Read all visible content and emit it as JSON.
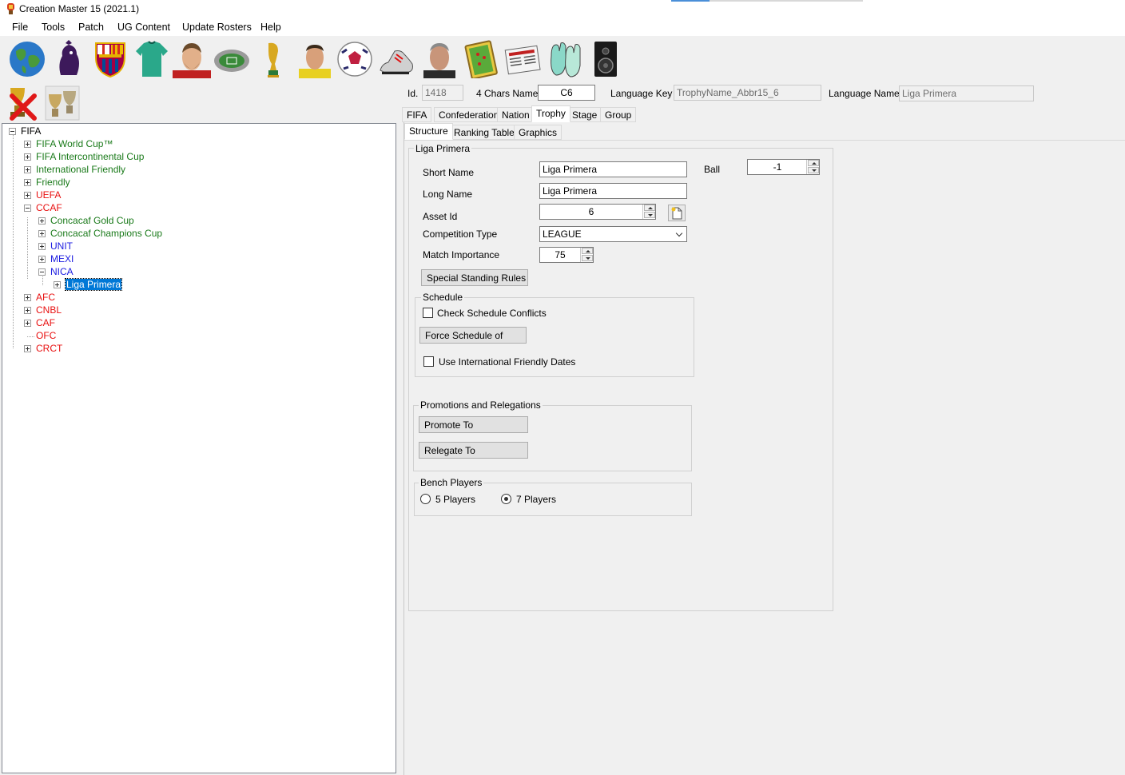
{
  "window": {
    "title": "Creation Master 15 (2021.1)"
  },
  "menu": [
    "File",
    "Tools",
    "Patch",
    "UG Content",
    "Update Rosters",
    "Help"
  ],
  "toolbar": {
    "icons": [
      "globe-icon",
      "premier-league-icon",
      "barcelona-crest-icon",
      "jersey-icon",
      "player-face-icon",
      "stadium-icon",
      "world-cup-trophy-icon",
      "referee-icon",
      "ball-icon",
      "boot-icon",
      "manager-face-icon",
      "formation-board-icon",
      "newspaper-icon",
      "goalkeeper-gloves-icon",
      "speaker-icon"
    ]
  },
  "left_toolbar": {
    "icons": [
      "delete-trophy-icon",
      "clone-trophy-icon"
    ]
  },
  "tree": [
    {
      "label": "FIFA",
      "level": 0,
      "color": "black",
      "box": "minus"
    },
    {
      "label": "FIFA World Cup™",
      "level": 1,
      "color": "green",
      "box": "plus"
    },
    {
      "label": "FIFA Intercontinental Cup",
      "level": 1,
      "color": "green",
      "box": "plus"
    },
    {
      "label": "International Friendly",
      "level": 1,
      "color": "green",
      "box": "plus"
    },
    {
      "label": "Friendly",
      "level": 1,
      "color": "green",
      "box": "plus"
    },
    {
      "label": "UEFA",
      "level": 1,
      "color": "red",
      "box": "plus"
    },
    {
      "label": "CCAF",
      "level": 1,
      "color": "red",
      "box": "minus"
    },
    {
      "label": "Concacaf Gold Cup",
      "level": 2,
      "color": "green",
      "box": "plus"
    },
    {
      "label": "Concacaf Champions Cup",
      "level": 2,
      "color": "green",
      "box": "plus"
    },
    {
      "label": "UNIT",
      "level": 2,
      "color": "blue",
      "box": "plus"
    },
    {
      "label": "MEXI",
      "level": 2,
      "color": "blue",
      "box": "plus"
    },
    {
      "label": "NICA",
      "level": 2,
      "color": "blue",
      "box": "minus"
    },
    {
      "label": "Liga Primera",
      "level": 3,
      "color": "selected",
      "box": "plus"
    },
    {
      "label": "AFC",
      "level": 1,
      "color": "red",
      "box": "plus"
    },
    {
      "label": "CNBL",
      "level": 1,
      "color": "red",
      "box": "plus"
    },
    {
      "label": "CAF",
      "level": 1,
      "color": "red",
      "box": "plus"
    },
    {
      "label": "OFC",
      "level": 1,
      "color": "red",
      "box": "none"
    },
    {
      "label": "CRCT",
      "level": 1,
      "color": "red",
      "box": "plus"
    }
  ],
  "header": {
    "id_label": "Id.",
    "id_value": "1418",
    "chars_label": "4 Chars Name",
    "chars_value": "C6",
    "langkey_label": "Language Key",
    "langkey_value": "TrophyName_Abbr15_6",
    "langname_label": "Language Name",
    "langname_value": "Liga Primera"
  },
  "tabs": [
    "FIFA",
    "Confederation",
    "Nation",
    "Trophy",
    "Stage",
    "Group"
  ],
  "subtabs": [
    "Structure",
    "Ranking Table",
    "Graphics"
  ],
  "form": {
    "group_title": "Liga Primera",
    "short_name_label": "Short Name",
    "short_name_value": "Liga Primera",
    "long_name_label": "Long Name",
    "long_name_value": "Liga Primera",
    "asset_id_label": "Asset Id",
    "asset_id_value": "6",
    "competition_type_label": "Competition Type",
    "competition_type_value": "LEAGUE",
    "match_importance_label": "Match Importance",
    "match_importance_value": "75",
    "ball_label": "Ball",
    "ball_value": "-1",
    "special_rules_button": "Special Standing Rules",
    "schedule_title": "Schedule",
    "check_conflicts_label": "Check Schedule Conflicts",
    "force_schedule_button": "Force Schedule of",
    "intl_dates_label": "Use International Friendly Dates",
    "promo_title": "Promotions and Relegations",
    "promote_button": "Promote To",
    "relegate_button": "Relegate To",
    "bench_title": "Bench Players",
    "five_players_label": "5 Players",
    "seven_players_label": "7 Players",
    "bench_selected": "7 Players"
  }
}
